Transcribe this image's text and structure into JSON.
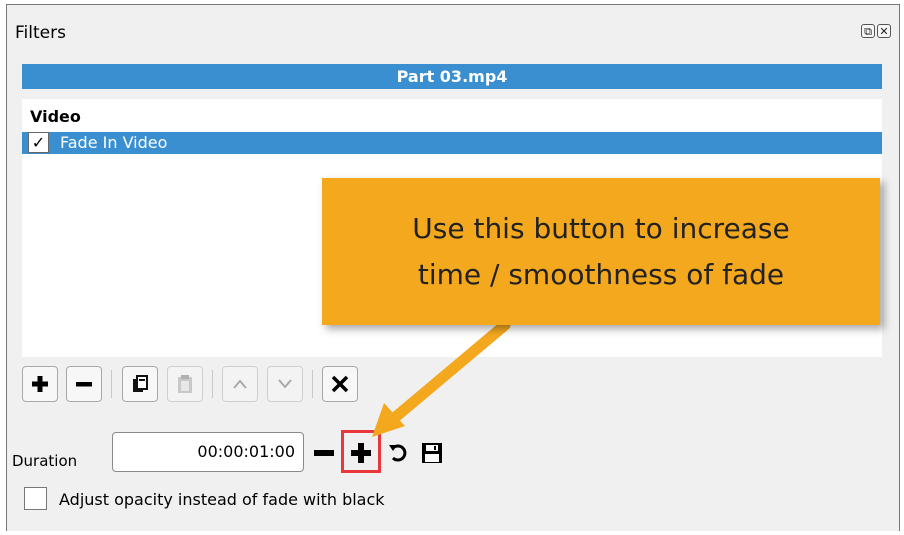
{
  "window": {
    "title": "Filters",
    "buttons": [
      "restore-icon",
      "close-icon"
    ]
  },
  "clip": {
    "name": "Part 03.mp4"
  },
  "filters": {
    "groups": [
      {
        "label": "Video",
        "items": [
          {
            "label": "Fade In Video",
            "checked": true,
            "selected": true
          }
        ]
      }
    ]
  },
  "toolbar": {
    "buttons": [
      {
        "icon": "plus-icon",
        "enabled": true
      },
      {
        "icon": "minus-icon",
        "enabled": true
      },
      {
        "icon": "copy-icon",
        "enabled": true
      },
      {
        "icon": "paste-icon",
        "enabled": false
      },
      {
        "icon": "move-up-icon",
        "enabled": false
      },
      {
        "icon": "move-down-icon",
        "enabled": false
      },
      {
        "icon": "close-x-icon",
        "enabled": true
      }
    ]
  },
  "duration": {
    "label": "Duration",
    "value": "00:00:01:00",
    "controls": [
      "minus-icon",
      "plus-icon",
      "reset-icon",
      "save-icon"
    ]
  },
  "opacity_option": {
    "label": "Adjust opacity instead of fade with black",
    "checked": false
  },
  "annotation": {
    "callout_line1": "Use this button to increase",
    "callout_line2": "time / smoothness of fade",
    "callout_color": "#f4a81e",
    "highlight_color": "#e8373d"
  },
  "colors": {
    "selection": "#3a8fd1",
    "panel": "#f0f0f0"
  }
}
